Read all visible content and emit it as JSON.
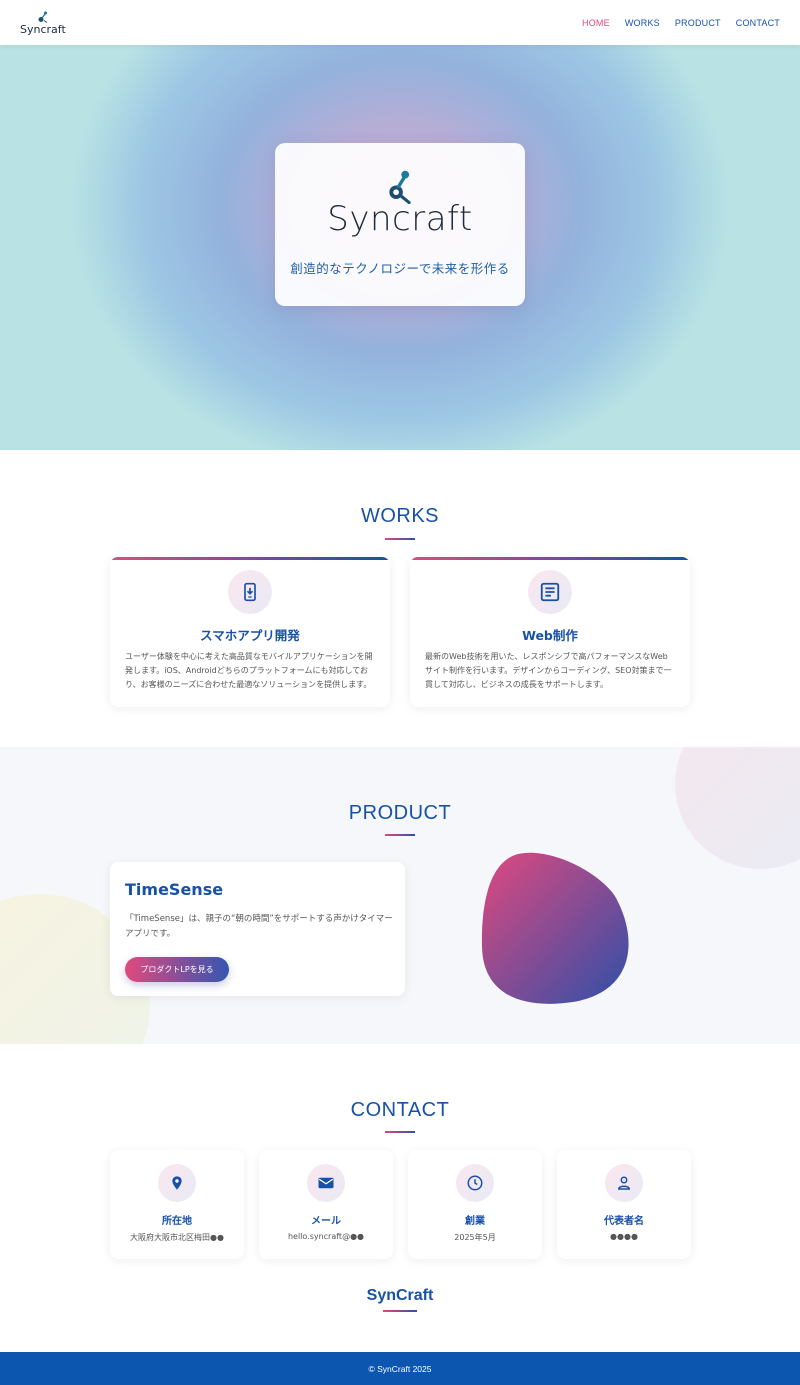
{
  "header": {
    "logo_text": "Syncraft",
    "nav": [
      "HOME",
      "WORKS",
      "PRODUCT",
      "CONTACT"
    ],
    "active_color": "#e0497e"
  },
  "hero": {
    "logo_text": "Syncraft",
    "tagline": "創造的なテクノロジーで未来を形作る"
  },
  "works": {
    "title": "WORKS",
    "items": [
      {
        "icon": "smartphone-download-icon",
        "title": "スマホアプリ開発",
        "desc": "ユーザー体験を中心に考えた高品質なモバイルアプリケーションを開発します。iOS、Androidどちらのプラットフォームにも対応しており、お客様のニーズに合わせた最適なソリューションを提供します。"
      },
      {
        "icon": "article-icon",
        "title": "Web制作",
        "desc": "最新のWeb技術を用いた、レスポンシブで高パフォーマンスなWebサイト制作を行います。デザインからコーディング、SEO対策まで一貫して対応し、ビジネスの成長をサポートします。"
      }
    ]
  },
  "product": {
    "title": "PRODUCT",
    "name": "TimeSense",
    "desc": "「TimeSense」は、親子の“朝の時間”をサポートする声かけタイマーアプリです。",
    "button": "プロダクトLPを見る"
  },
  "contact": {
    "title": "CONTACT",
    "items": [
      {
        "icon": "location-pin-icon",
        "label": "所在地",
        "value": "大阪府大阪市北区梅田●●"
      },
      {
        "icon": "mail-icon",
        "label": "メール",
        "value": "hello.syncraft@●●"
      },
      {
        "icon": "clock-icon",
        "label": "創業",
        "value": "2025年5月"
      },
      {
        "icon": "person-icon",
        "label": "代表者名",
        "value": "●●●●"
      }
    ]
  },
  "footer": {
    "brand": "SynCraft",
    "copyright": "© SynCraft 2025"
  },
  "colors": {
    "primary": "#1751a8",
    "accent": "#e0497e",
    "footer_bg": "#0d56b0"
  }
}
